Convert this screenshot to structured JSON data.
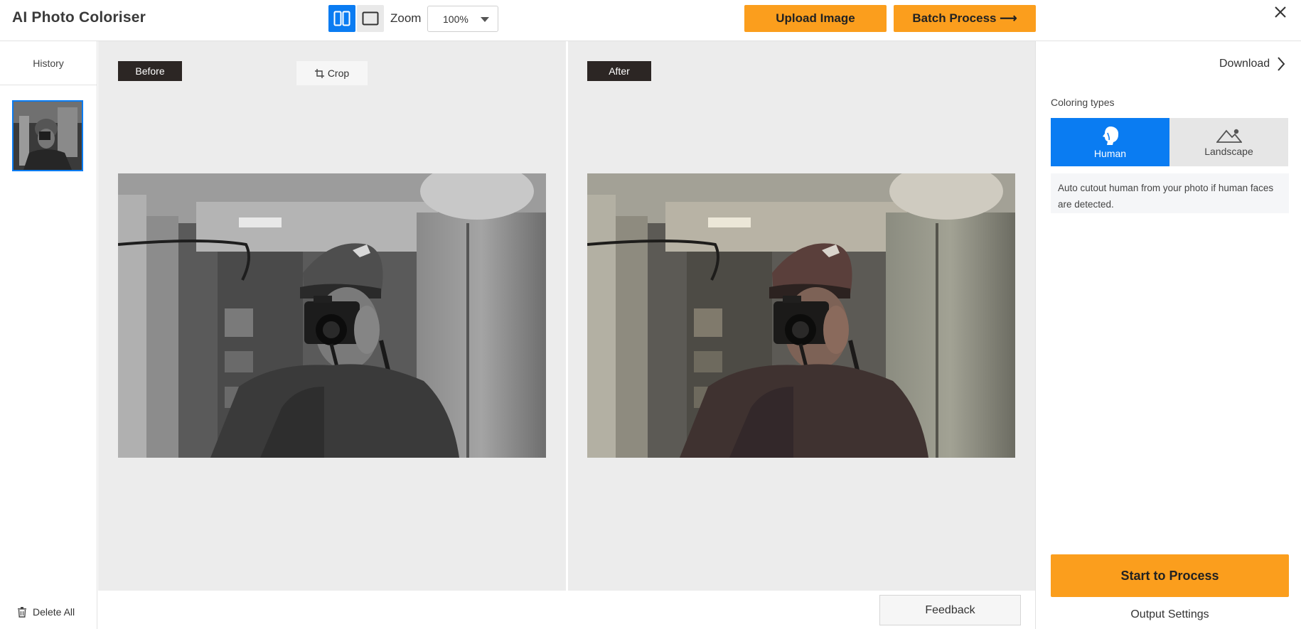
{
  "app": {
    "title": "AI Photo Coloriser"
  },
  "toolbar": {
    "zoom_label": "Zoom",
    "zoom_value": "100%",
    "upload_label": "Upload Image",
    "batch_label": "Batch Process ⟶",
    "view_mode": "split"
  },
  "sidebar": {
    "history_label": "History",
    "delete_all_label": "Delete All"
  },
  "workspace": {
    "before_label": "Before",
    "after_label": "After",
    "crop_label": "Crop",
    "feedback_label": "Feedback"
  },
  "panel": {
    "download_label": "Download",
    "coloring_types_label": "Coloring types",
    "types": [
      {
        "label": "Human",
        "icon": "human-head-icon",
        "selected": true
      },
      {
        "label": "Landscape",
        "icon": "mountain-icon",
        "selected": false
      }
    ],
    "description": "Auto cutout human from your photo if human faces are detected.",
    "start_label": "Start to Process",
    "output_settings_label": "Output Settings"
  },
  "colors": {
    "accent_blue": "#0a7cf2",
    "accent_orange": "#fb9e1d",
    "tag_dark": "#2c2624",
    "workspace_bg": "#ececec"
  }
}
